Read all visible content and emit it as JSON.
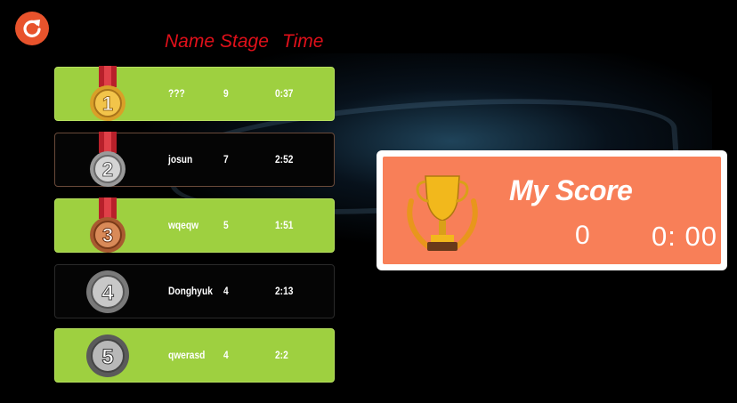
{
  "header": {
    "name": "Name",
    "stage": "Stage",
    "time": "Time"
  },
  "leaderboard": [
    {
      "rank": "1",
      "name": "???",
      "stage": "9",
      "time": "0:37",
      "medal": "gold-medal"
    },
    {
      "rank": "2",
      "name": "josun",
      "stage": "7",
      "time": "2:52",
      "medal": "silver-medal"
    },
    {
      "rank": "3",
      "name": "wqeqw",
      "stage": "5",
      "time": "1:51",
      "medal": "bronze-medal"
    },
    {
      "rank": "4",
      "name": "Donghyuk",
      "stage": "4",
      "time": "2:13",
      "medal": "silver-wreath"
    },
    {
      "rank": "5",
      "name": "qwerasd",
      "stage": "4",
      "time": "2:2",
      "medal": "silver-wreath"
    }
  ],
  "my_score": {
    "title": "My Score",
    "stage": "0",
    "time": "0: 00"
  },
  "icons": {
    "refresh": "refresh-icon",
    "trophy": "trophy-icon"
  },
  "colors": {
    "row_green": "#9ed040",
    "header_red": "#e0101a",
    "card_orange": "#f87f58",
    "refresh": "#e8532c"
  }
}
